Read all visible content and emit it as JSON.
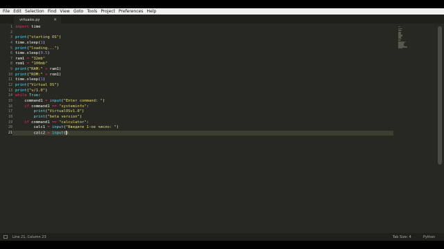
{
  "menu": [
    "File",
    "Edit",
    "Selection",
    "Find",
    "View",
    "Goto",
    "Tools",
    "Project",
    "Preferences",
    "Help"
  ],
  "tab": {
    "title": "virtualos.py",
    "close": "×"
  },
  "editor": {
    "current_line": 21,
    "lines": [
      [
        [
          "kw",
          "import"
        ],
        [
          "ident",
          " time"
        ]
      ],
      [],
      [
        [
          "fn",
          "print"
        ],
        [
          "ident",
          "("
        ],
        [
          "st",
          "\"starting OS\""
        ],
        [
          "ident",
          ")"
        ]
      ],
      [
        [
          "ident",
          "time.sleep("
        ],
        [
          "nu",
          "1"
        ],
        [
          "ident",
          ")"
        ]
      ],
      [
        [
          "fn",
          "print"
        ],
        [
          "ident",
          "("
        ],
        [
          "st",
          "\"loading...\""
        ],
        [
          "ident",
          ")"
        ]
      ],
      [
        [
          "ident",
          "time.sleep("
        ],
        [
          "nu",
          "0.5"
        ],
        [
          "ident",
          ")"
        ]
      ],
      [
        [
          "ident",
          "ram1 "
        ],
        [
          "kw",
          "="
        ],
        [
          "ident",
          " "
        ],
        [
          "st",
          "\"32mb\""
        ]
      ],
      [
        [
          "ident",
          "rom1 "
        ],
        [
          "kw",
          "="
        ],
        [
          "ident",
          " "
        ],
        [
          "st",
          "\"100mb\""
        ]
      ],
      [
        [
          "fn",
          "print"
        ],
        [
          "ident",
          "("
        ],
        [
          "st",
          "\"RAM:\""
        ],
        [
          "ident",
          " "
        ],
        [
          "kw",
          "+"
        ],
        [
          "ident",
          " ram1)"
        ]
      ],
      [
        [
          "fn",
          "print"
        ],
        [
          "ident",
          "("
        ],
        [
          "st",
          "\"ROM:\""
        ],
        [
          "ident",
          " "
        ],
        [
          "kw",
          "+"
        ],
        [
          "ident",
          " rom1)"
        ]
      ],
      [
        [
          "ident",
          "time.sleep("
        ],
        [
          "nu",
          "1"
        ],
        [
          "ident",
          ")"
        ]
      ],
      [
        [
          "fn",
          "print"
        ],
        [
          "ident",
          "("
        ],
        [
          "st",
          "\"Virtual OS\""
        ],
        [
          "ident",
          ")"
        ]
      ],
      [
        [
          "fn",
          "print"
        ],
        [
          "ident",
          "("
        ],
        [
          "st",
          "\"v/1.0\""
        ],
        [
          "ident",
          ")"
        ]
      ],
      [
        [
          "kw",
          "while"
        ],
        [
          "ident",
          " "
        ],
        [
          "fn",
          "True"
        ],
        [
          "ident",
          ":"
        ]
      ],
      [
        [
          "ident",
          "    command1 "
        ],
        [
          "kw",
          "="
        ],
        [
          "ident",
          " "
        ],
        [
          "fn",
          "input"
        ],
        [
          "ident",
          "("
        ],
        [
          "st",
          "\"Enter command: \""
        ],
        [
          "ident",
          ")"
        ]
      ],
      [
        [
          "ident",
          "    "
        ],
        [
          "kw",
          "if"
        ],
        [
          "ident",
          " command1 "
        ],
        [
          "kw",
          "=="
        ],
        [
          "ident",
          " "
        ],
        [
          "st",
          "\"systeminfo\""
        ],
        [
          "ident",
          ":"
        ]
      ],
      [
        [
          "ident",
          "        "
        ],
        [
          "fn",
          "print"
        ],
        [
          "ident",
          "("
        ],
        [
          "st",
          "\"VirtualOSv1.0\""
        ],
        [
          "ident",
          ")"
        ]
      ],
      [
        [
          "ident",
          "        "
        ],
        [
          "fn",
          "print"
        ],
        [
          "ident",
          "("
        ],
        [
          "st",
          "\"beta version\""
        ],
        [
          "ident",
          ")"
        ]
      ],
      [
        [
          "ident",
          "    "
        ],
        [
          "kw",
          "if"
        ],
        [
          "ident",
          " command1 "
        ],
        [
          "kw",
          "=="
        ],
        [
          "ident",
          " "
        ],
        [
          "st",
          "\"calculator\""
        ],
        [
          "ident",
          ":"
        ]
      ],
      [
        [
          "ident",
          "        calc1 "
        ],
        [
          "kw",
          "="
        ],
        [
          "ident",
          " "
        ],
        [
          "fn",
          "input"
        ],
        [
          "ident",
          "("
        ],
        [
          "st",
          "\"Введите 1-ое число: \""
        ],
        [
          "ident",
          ")"
        ]
      ],
      [
        [
          "ident",
          "        calc2 "
        ],
        [
          "kw",
          "="
        ],
        [
          "ident",
          " "
        ],
        [
          "fn",
          "input"
        ],
        [
          "ident",
          "("
        ],
        [
          "ident",
          ")"
        ]
      ]
    ]
  },
  "status": {
    "position": "Line 21, Column 23",
    "indent": "Tab Size: 4",
    "syntax": "Python"
  }
}
